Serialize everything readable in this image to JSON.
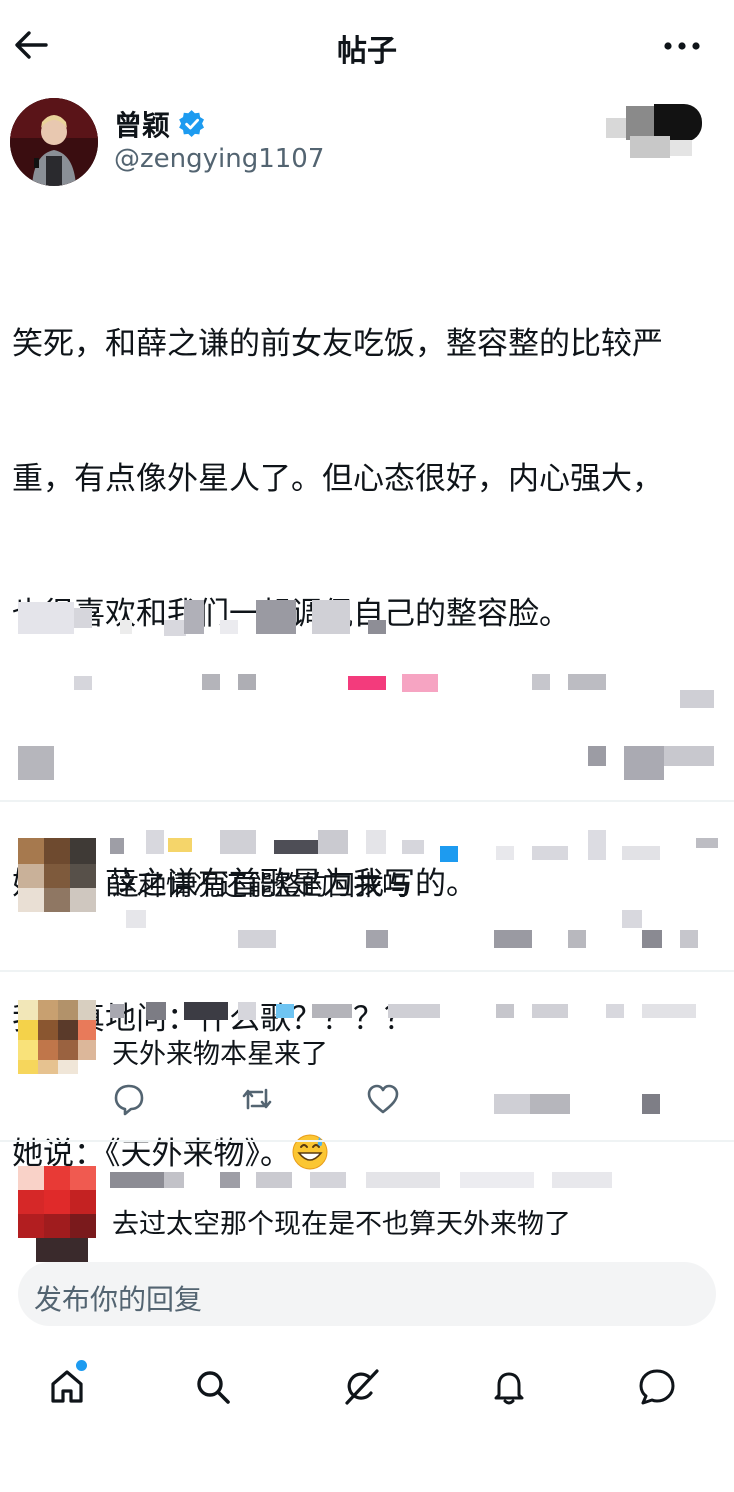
{
  "header": {
    "title": "帖子",
    "back_icon": "arrow-left-icon",
    "more_icon": "more-horizontal-icon"
  },
  "post": {
    "author_name": "曾颖",
    "author_handle": "@zengying1107",
    "verified": true,
    "text_lines": [
      "笑死，和薛之谦的前女友吃饭，整容整的比较严",
      "重，有点像外星人了。但心态很好，内心强大，",
      "也很喜欢和我们一起调侃自己的整容脸。",
      "",
      "她说：薛之谦有首歌是为我写的。",
      "我认真地问：什么歌？？？？",
      "她说：《天外来物》。"
    ],
    "emoji": "grinning-sweat-emoji"
  },
  "replies": [
    {
      "text": "这种情况还能整的回来吗"
    },
    {
      "text": "天外来物本星来了"
    },
    {
      "text": "去过太空那个现在是不也算天外来物了"
    }
  ],
  "reply_actions": {
    "reply_icon": "comment-icon",
    "retweet_icon": "retweet-icon",
    "like_icon": "heart-icon"
  },
  "compose": {
    "placeholder": "发布你的回复"
  },
  "bottom_nav": [
    {
      "icon": "home-icon",
      "has_notification_dot": true
    },
    {
      "icon": "search-icon"
    },
    {
      "icon": "grok-icon"
    },
    {
      "icon": "bell-icon"
    },
    {
      "icon": "messages-icon"
    }
  ],
  "colors": {
    "accent": "#1d9bf0",
    "text_primary": "#0f1419",
    "text_secondary": "#536471"
  }
}
